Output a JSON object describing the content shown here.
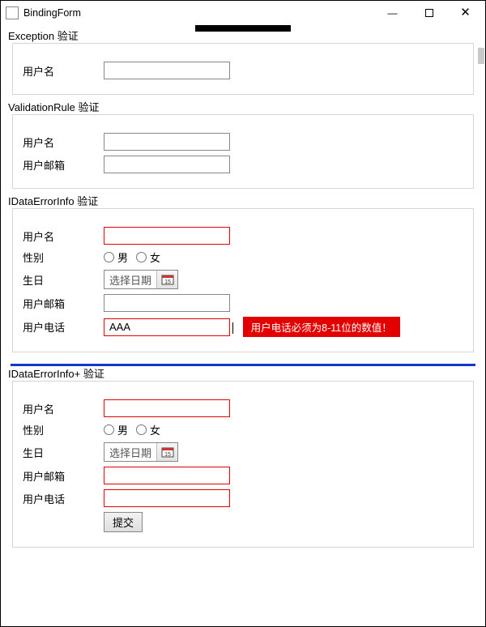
{
  "window": {
    "title": "BindingForm"
  },
  "labels": {
    "username": "用户名",
    "email": "用户邮箱",
    "gender": "性别",
    "male": "男",
    "female": "女",
    "birthday": "生日",
    "date_placeholder": "选择日期",
    "phone": "用户电话",
    "submit": "提交"
  },
  "sections": {
    "exception": {
      "title": "Exception 验证",
      "username_value": ""
    },
    "validation_rule": {
      "title": "ValidationRule 验证",
      "username_value": "",
      "email_value": ""
    },
    "idataerrorinfo": {
      "title": "IDataErrorInfo 验证",
      "username_value": "",
      "email_value": "",
      "phone_value": "AAA",
      "phone_error": "用户电话必须为8-11位的数值！"
    },
    "idataerrorinfo_plus": {
      "title": "IDataErrorInfo+ 验证",
      "username_value": "",
      "email_value": "",
      "phone_value": ""
    }
  }
}
